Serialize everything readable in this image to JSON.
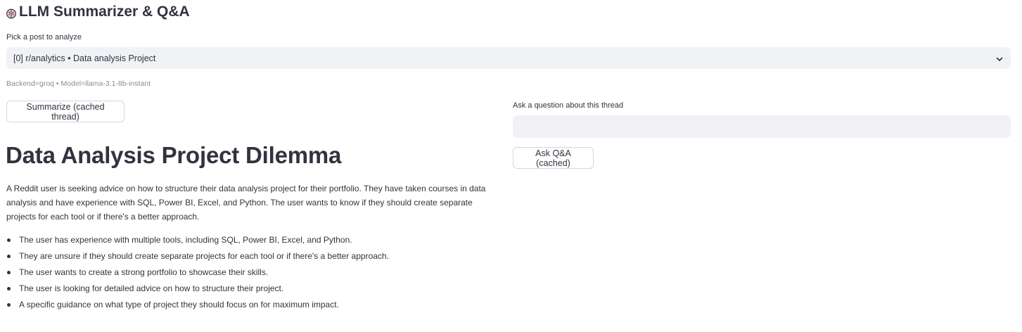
{
  "app": {
    "title": "LLM Summarizer & Q&A",
    "title_icon": "brain-icon"
  },
  "post_select": {
    "label": "Pick a post to analyze",
    "selected": "[0] r/analytics • Data analysis Project",
    "icon": "chevron-down-icon"
  },
  "backend_caption": "Backend=groq • Model=llama-3.1-8b-instant",
  "summarize_button": {
    "label": "Summarize (cached thread)"
  },
  "qa": {
    "label": "Ask a question about this thread",
    "value": "",
    "button_label": "Ask Q&A (cached)"
  },
  "summary": {
    "heading": "Data Analysis Project Dilemma",
    "paragraph": "A Reddit user is seeking advice on how to structure their data analysis project for their portfolio. They have taken courses in data analysis and have experience with SQL, Power BI, Excel, and Python. The user wants to know if they should create separate projects for each tool or if there's a better approach.",
    "bullets": [
      "The user has experience with multiple tools, including SQL, Power BI, Excel, and Python.",
      "They are unsure if they should create separate projects for each tool or if there's a better approach.",
      "The user wants to create a strong portfolio to showcase their skills.",
      "The user is looking for detailed advice on how to structure their project.",
      "A specific guidance on what type of project they should focus on for maximum impact."
    ]
  },
  "colors": {
    "text": "#31333f",
    "input_bg": "#f0f2f6",
    "caption": "#8a8c93",
    "border": "#d4d6dc"
  }
}
